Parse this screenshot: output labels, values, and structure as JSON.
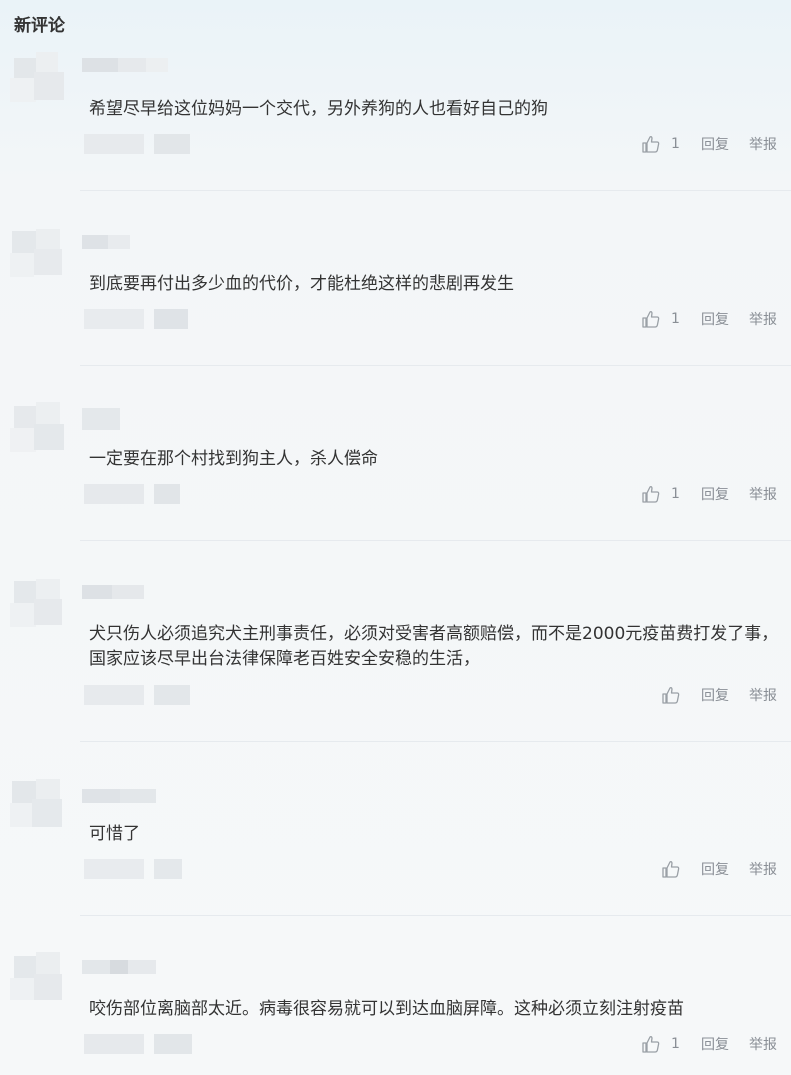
{
  "header": {
    "title": "新评论"
  },
  "comments": [
    {
      "text": "希望尽早给这位妈妈一个交代，另外养狗的人也看好自己的狗",
      "likes": "1",
      "reply_label": "回复",
      "report_label": "举报"
    },
    {
      "text": "到底要再付出多少血的代价，才能杜绝这样的悲剧再发生",
      "likes": "1",
      "reply_label": "回复",
      "report_label": "举报"
    },
    {
      "text": "一定要在那个村找到狗主人，杀人偿命",
      "likes": "1",
      "reply_label": "回复",
      "report_label": "举报"
    },
    {
      "text": "犬只伤人必须追究犬主刑事责任，必须对受害者高额赔偿，而不是2000元疫苗费打发了事，国家应该尽早出台法律保障老百姓安全安稳的生活，",
      "likes": "",
      "reply_label": "回复",
      "report_label": "举报"
    },
    {
      "text": "可惜了",
      "likes": "",
      "reply_label": "回复",
      "report_label": "举报"
    },
    {
      "text": "咬伤部位离脑部太近。病毒很容易就可以到达血脑屏障。这种必须立刻注射疫苗",
      "likes": "1",
      "reply_label": "回复",
      "report_label": "举报"
    }
  ]
}
